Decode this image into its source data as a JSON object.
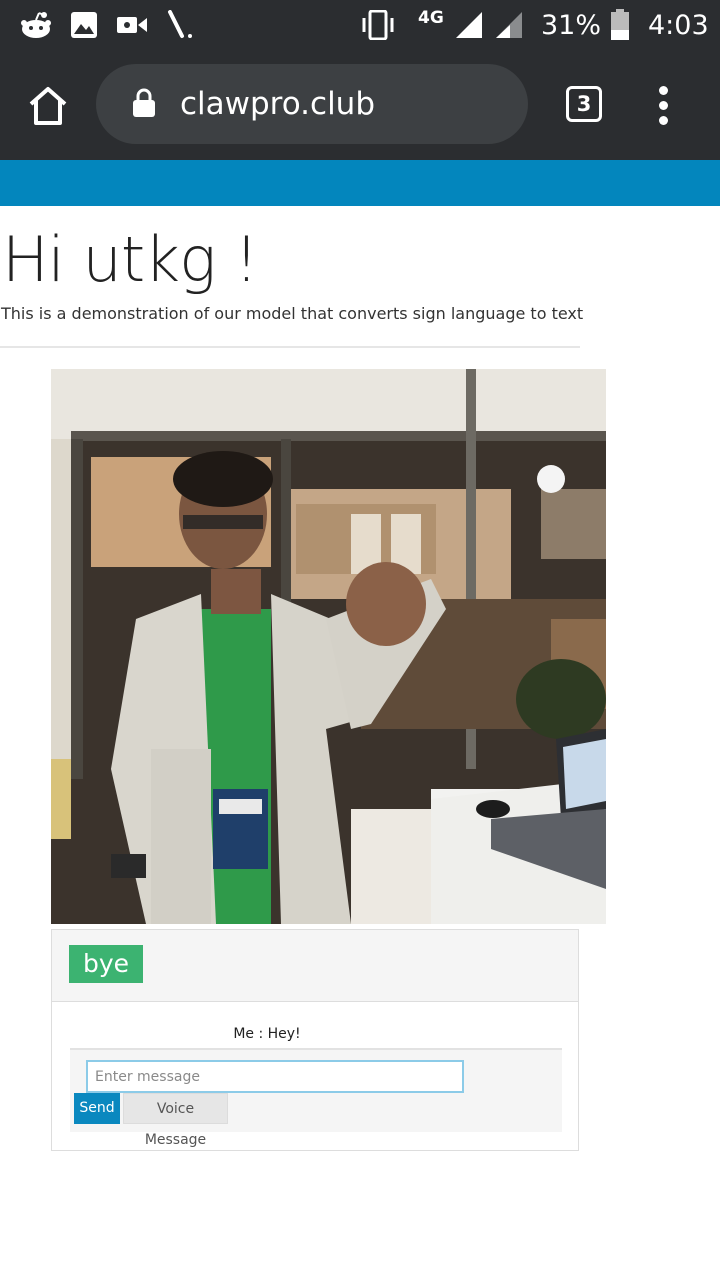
{
  "status_bar": {
    "network": "4G",
    "battery": "31%",
    "time": "4:03",
    "icons": [
      "reddit-icon",
      "gallery-icon",
      "video-icon",
      "brush-icon",
      "vibrate-icon",
      "signal-icon",
      "battery-icon"
    ]
  },
  "browser": {
    "url": "clawpro.club",
    "tab_count": "3"
  },
  "colors": {
    "banner": "#0386bd",
    "prediction": "#3cb371",
    "send": "#0a88bf"
  },
  "page": {
    "greeting": "Hi utkg !",
    "subtitle": "This is a demonstration of our model that converts sign language to text"
  },
  "prediction": "bye",
  "chat": {
    "messages": [
      {
        "text": "Me : Hey!"
      }
    ],
    "input_placeholder": "Enter message",
    "send_label": "Send",
    "voice_label": "Voice Message"
  }
}
